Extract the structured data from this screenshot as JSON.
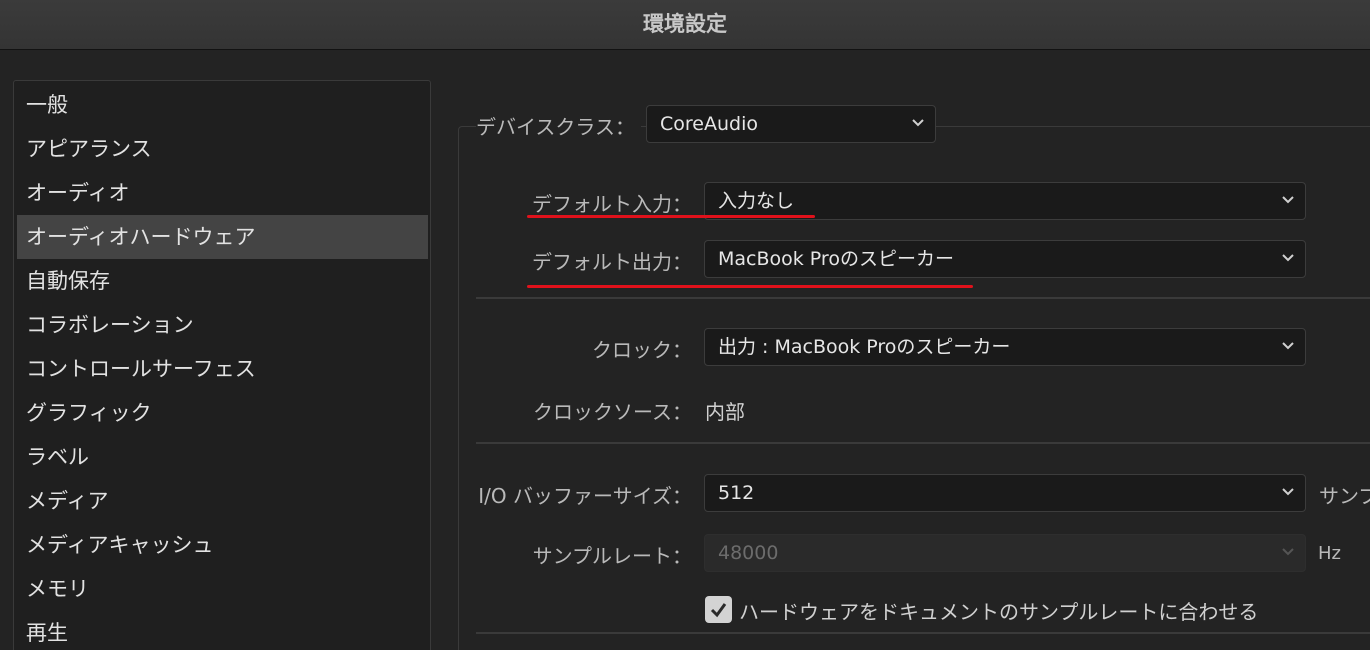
{
  "window": {
    "title": "環境設定"
  },
  "sidebar": {
    "items": [
      {
        "label": "一般"
      },
      {
        "label": "アピアランス"
      },
      {
        "label": "オーディオ"
      },
      {
        "label": "オーディオハードウェア",
        "selected": true
      },
      {
        "label": "自動保存"
      },
      {
        "label": "コラボレーション"
      },
      {
        "label": "コントロールサーフェス"
      },
      {
        "label": "グラフィック"
      },
      {
        "label": "ラベル"
      },
      {
        "label": "メディア"
      },
      {
        "label": "メディアキャッシュ"
      },
      {
        "label": "メモリ"
      },
      {
        "label": "再生"
      }
    ]
  },
  "audio_hardware": {
    "device_class": {
      "label": "デバイスクラス：",
      "value": "CoreAudio"
    },
    "default_input": {
      "label": "デフォルト入力：",
      "value": "入力なし"
    },
    "default_output": {
      "label": "デフォルト出力：",
      "value": "MacBook Proのスピーカー"
    },
    "clock": {
      "label": "クロック：",
      "value": "出力 : MacBook Proのスピーカー"
    },
    "clock_source": {
      "label": "クロックソース：",
      "value": "内部"
    },
    "io_buffer_size": {
      "label": "I/O バッファーサイズ：",
      "value": "512",
      "suffix": "サンプ"
    },
    "sample_rate": {
      "label": "サンプルレート：",
      "value": "48000",
      "unit": "Hz",
      "disabled": true
    },
    "match_sample_rate": {
      "label": "ハードウェアをドキュメントのサンプルレートに合わせる",
      "checked": true
    }
  },
  "colors": {
    "background": "#232323",
    "panel": "#1f1f1f",
    "selected_item": "#444444",
    "annotation_underline": "#e0111b"
  },
  "icons": {
    "dropdown": "chevron-down-icon",
    "check": "checkmark-icon"
  }
}
